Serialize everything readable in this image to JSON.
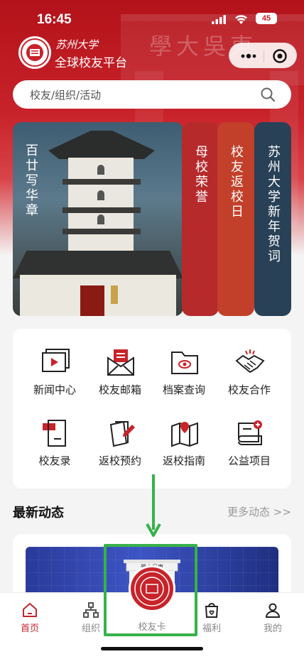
{
  "status_bar": {
    "time": "16:45",
    "battery": "45"
  },
  "header": {
    "brand_script": "苏州大学",
    "brand_title": "全球校友平台",
    "background_gate_text": "學大吳東"
  },
  "search": {
    "placeholder": "校友/组织/活动"
  },
  "banner": {
    "main_title": "百廿写华章",
    "tabs": [
      {
        "label": "母校荣誉",
        "color": "#b62a2b"
      },
      {
        "label": "校友返校日",
        "color": "#c2402a"
      },
      {
        "label": "苏州大学新年贺词",
        "color": "#284156"
      }
    ]
  },
  "services": [
    {
      "label": "新闻中心",
      "icon": "news-center-icon"
    },
    {
      "label": "校友邮箱",
      "icon": "mailbox-icon"
    },
    {
      "label": "档案查询",
      "icon": "archive-folder-icon"
    },
    {
      "label": "校友合作",
      "icon": "handshake-icon"
    },
    {
      "label": "校友录",
      "icon": "directory-icon"
    },
    {
      "label": "返校预约",
      "icon": "booking-icon"
    },
    {
      "label": "返校指南",
      "icon": "map-guide-icon"
    },
    {
      "label": "公益项目",
      "icon": "charity-certificate-icon"
    }
  ],
  "news": {
    "title": "最新动态",
    "more": "更多动态 >>"
  },
  "tab_bar": {
    "items": [
      {
        "label": "首页",
        "icon": "home-icon",
        "active": true
      },
      {
        "label": "组织",
        "icon": "org-chart-icon",
        "active": false
      },
      {
        "label": "校友卡",
        "icon": "alumni-card-badge-icon",
        "active": false
      },
      {
        "label": "福利",
        "icon": "gift-bag-icon",
        "active": false
      },
      {
        "label": "我的",
        "icon": "user-icon",
        "active": false
      }
    ],
    "center_gate_text": "學大吳東"
  },
  "colors": {
    "brand_red": "#c8232a",
    "active_tab": "#c1272d",
    "annotation_green": "#36b24a"
  }
}
